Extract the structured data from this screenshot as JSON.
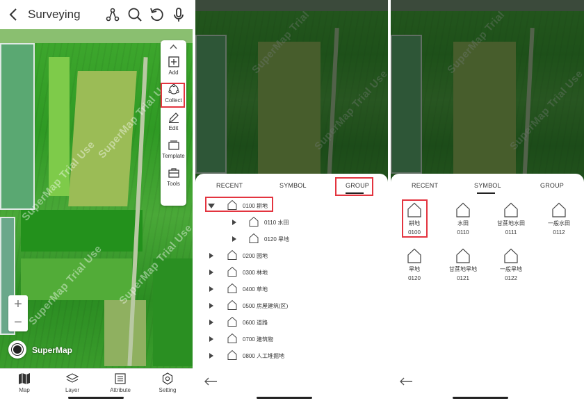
{
  "panel1": {
    "title": "Surveying",
    "icons": [
      "back-icon",
      "route-icon",
      "search-icon",
      "undo-icon",
      "mic-icon"
    ],
    "toolbar": [
      {
        "name": "add",
        "label": "Add",
        "icon": "plus-square-icon"
      },
      {
        "name": "collect",
        "label": "Collect",
        "icon": "collect-icon",
        "highlighted": true
      },
      {
        "name": "edit",
        "label": "Edit",
        "icon": "pencil-icon"
      },
      {
        "name": "template",
        "label": "Template",
        "icon": "template-icon"
      },
      {
        "name": "tools",
        "label": "Tools",
        "icon": "toolbox-icon"
      }
    ],
    "zoom": {
      "in": "+",
      "out": "−"
    },
    "logo_text": "SuperMap",
    "watermark": "SuperMap Trial Use",
    "bottom_nav": [
      {
        "name": "map",
        "label": "Map",
        "icon": "map-icon"
      },
      {
        "name": "layer",
        "label": "Layer",
        "icon": "layers-icon"
      },
      {
        "name": "attribute",
        "label": "Attribute",
        "icon": "table-icon"
      },
      {
        "name": "setting",
        "label": "Setting",
        "icon": "gear-icon"
      }
    ]
  },
  "panel2": {
    "tabs": [
      "RECENT",
      "SYMBOL",
      "GROUP"
    ],
    "active_tab": "GROUP",
    "tree": [
      {
        "label": "0100 耕地",
        "expanded": true,
        "level": 0,
        "highlighted": true
      },
      {
        "label": "0110 水田",
        "level": 1
      },
      {
        "label": "0120 旱地",
        "level": 1
      },
      {
        "label": "0200 园地",
        "level": 0
      },
      {
        "label": "0300 林地",
        "level": 0
      },
      {
        "label": "0400 草地",
        "level": 0
      },
      {
        "label": "0500 房屋建筑(区)",
        "level": 0
      },
      {
        "label": "0600 道路",
        "level": 0
      },
      {
        "label": "0700 建筑物",
        "level": 0
      },
      {
        "label": "0800 人工堆掘地",
        "level": 0
      }
    ]
  },
  "panel3": {
    "tabs": [
      "RECENT",
      "SYMBOL",
      "GROUP"
    ],
    "active_tab": "SYMBOL",
    "symbols": [
      {
        "name": "耕地",
        "code": "0100",
        "highlighted": true
      },
      {
        "name": "水田",
        "code": "0110"
      },
      {
        "name": "甘蔗地水田",
        "code": "0111"
      },
      {
        "name": "一般水田",
        "code": "0112"
      },
      {
        "name": "旱地",
        "code": "0120"
      },
      {
        "name": "甘蔗地旱地",
        "code": "0121"
      },
      {
        "name": "一般旱地",
        "code": "0122"
      }
    ]
  },
  "colors": {
    "highlight": "#e3343f",
    "map_green": "#3fa82e",
    "text": "#333333"
  }
}
